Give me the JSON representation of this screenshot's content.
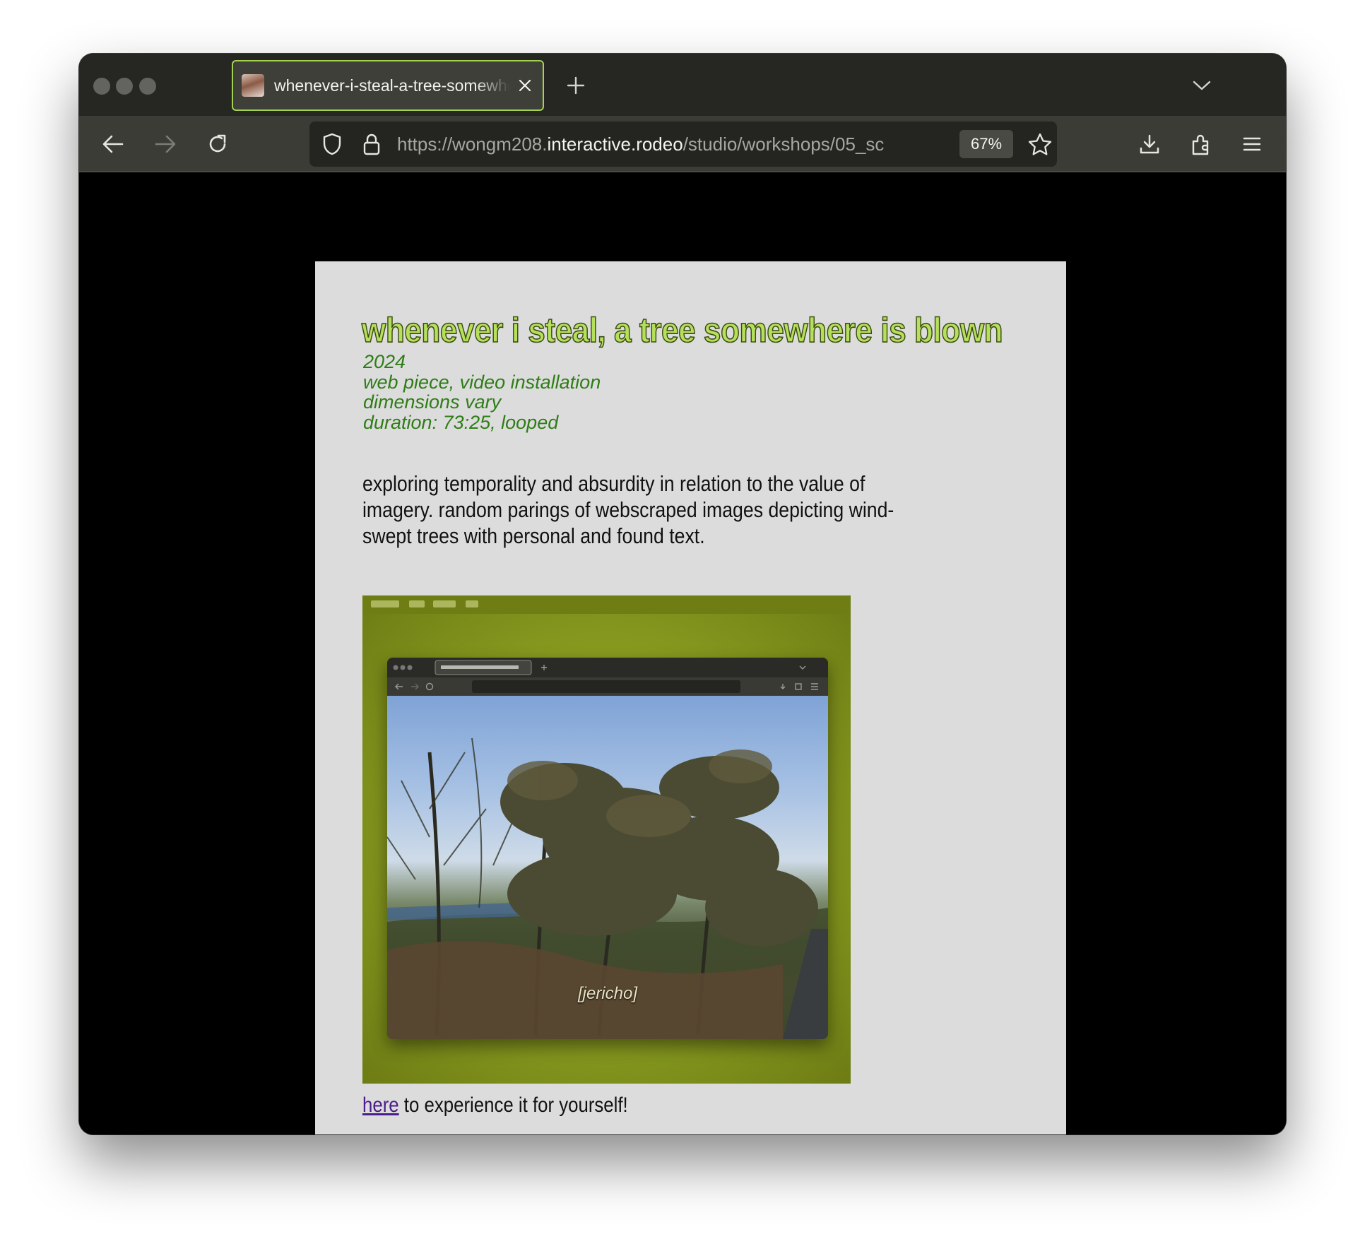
{
  "browser": {
    "tab": {
      "title": "whenever-i-steal-a-tree-somewhere-is-blown",
      "favicon": "portrait-favicon"
    },
    "url": {
      "prefix": "https://wongm208.",
      "host": "interactive.rodeo",
      "path": "/studio/workshops/05_sc"
    },
    "zoom": "67%",
    "accent_color": "#a5d150",
    "icons": [
      "back-arrow-icon",
      "forward-arrow-icon",
      "reload-icon",
      "shield-icon",
      "lock-icon",
      "star-icon",
      "download-icon",
      "extensions-icon",
      "menu-icon",
      "close-icon",
      "plus-icon",
      "chevron-down-icon"
    ]
  },
  "page": {
    "title": "whenever i steal, a tree somewhere is blown",
    "meta": [
      "2024",
      "web piece, video installation",
      "dimensions vary",
      "duration: 73:25, looped"
    ],
    "description": [
      "exploring temporality and absurdity in relation to the value of",
      "imagery. random parings of webscraped images depicting wind-",
      "swept trees with personal and found text."
    ],
    "image_caption": "[jericho]",
    "link_text": "here",
    "link_suffix": " to experience it for yourself!",
    "colors": {
      "title_fill": "#b4e05c",
      "meta_text": "#2e7d16",
      "page_background": "#dcdcdc",
      "link": "#4a1d8a"
    }
  }
}
